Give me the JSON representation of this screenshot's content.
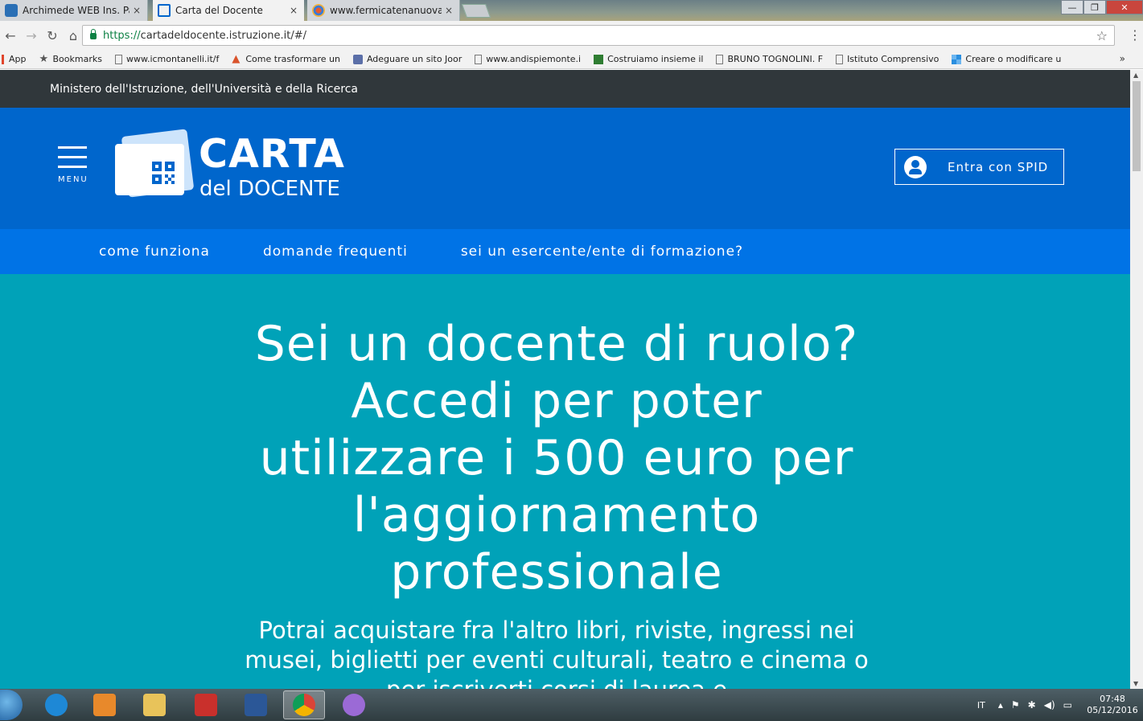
{
  "browser": {
    "tabs": [
      {
        "title": "Archimede WEB Ins. Patr",
        "active": false,
        "favicon_color": "#2a6fb5"
      },
      {
        "title": "Carta del Docente",
        "active": true,
        "favicon_color": "#0066cc"
      },
      {
        "title": "www.fermicatenanuova",
        "active": false,
        "favicon_color": "#e85b2e"
      }
    ],
    "tab_close_glyph": "×",
    "window_buttons": {
      "minimize": "—",
      "maximize": "❐",
      "close": "✕"
    },
    "url_scheme": "https://",
    "url_rest": "cartadeldocente.istruzione.it/#/",
    "bookmarks": [
      {
        "label": "App",
        "icon": "apps-icon",
        "color": "#e0452c"
      },
      {
        "label": "Bookmarks",
        "icon": "star-icon",
        "color": "#555555"
      },
      {
        "label": "www.icmontanelli.it/f",
        "icon": "page-icon",
        "color": "#777777"
      },
      {
        "label": "Come trasformare un",
        "icon": "adobe-icon",
        "color": "#d9532b"
      },
      {
        "label": "Adeguare un sito Joor",
        "icon": "joomla-icon",
        "color": "#5b6fa8"
      },
      {
        "label": "www.andispiemonte.i",
        "icon": "page-icon",
        "color": "#777777"
      },
      {
        "label": "Costruiamo insieme il",
        "icon": "site-icon",
        "color": "#2f7d32"
      },
      {
        "label": "BRUNO TOGNOLINI. F",
        "icon": "page-icon",
        "color": "#777777"
      },
      {
        "label": "Istituto Comprensivo",
        "icon": "page-icon",
        "color": "#777777"
      },
      {
        "label": "Creare o modificare u",
        "icon": "windows-icon",
        "color": "#2b8fe0"
      }
    ],
    "bookmarks_more": "»"
  },
  "site": {
    "ministry": "Ministero dell'Istruzione, dell'Università e della Ricerca",
    "menu_label": "MENU",
    "brand_title": "CARTA",
    "brand_subtitle": "del DOCENTE",
    "spid_label": "Entra con SPID",
    "nav": [
      "come funziona",
      "domande frequenti",
      "sei un esercente/ente di formazione?"
    ],
    "hero_title": "Sei un docente di ruolo? Accedi per poter utilizzare i 500 euro per l'aggiornamento professionale",
    "hero_text": "Potrai acquistare fra l'altro libri, riviste, ingressi nei musei, biglietti per eventi culturali, teatro e cinema o per iscriverti corsi di laurea e",
    "colors": {
      "ministry_bar": "#30373b",
      "header": "#0066cc",
      "subnav": "#0073e6",
      "hero": "#00a2b8"
    }
  },
  "taskbar": {
    "apps": [
      {
        "name": "ie-icon",
        "color": "#1e88d6",
        "active": false
      },
      {
        "name": "media-player-icon",
        "color": "#e8892b",
        "active": false
      },
      {
        "name": "file-explorer-icon",
        "color": "#e8c35a",
        "active": false
      },
      {
        "name": "pdf-icon",
        "color": "#c9302c",
        "active": false
      },
      {
        "name": "word-icon",
        "color": "#2b5797",
        "active": false
      },
      {
        "name": "chrome-icon",
        "color": "#4caf50",
        "active": true
      },
      {
        "name": "paint-icon",
        "color": "#9b6ad6",
        "active": false
      }
    ],
    "language": "IT",
    "time": "07:48",
    "date": "05/12/2016"
  }
}
